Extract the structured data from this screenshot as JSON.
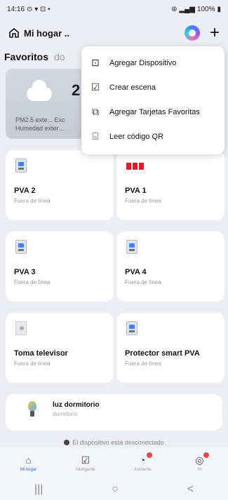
{
  "status_bar": {
    "time": "14:16",
    "left_icons": "⊙ ▾ ⊡ •",
    "right_text": "100%"
  },
  "header": {
    "home_title": "Mi hogar ..",
    "home_icon": "home-icon",
    "assistant_icon": "assistant-icon",
    "plus_icon": "plus-icon"
  },
  "tabs": {
    "active": "Favoritos",
    "inactive": "do"
  },
  "weather": {
    "temp": "2",
    "line1": "PM2.5 exte...  Exc",
    "line2": "Humedad exter..."
  },
  "devices": [
    {
      "name": "PVA 2",
      "status": "Fuera de línea"
    },
    {
      "name": "PVA 1",
      "status": "Fuera de línea"
    },
    {
      "name": "PVA 3",
      "status": "Fuera de línea"
    },
    {
      "name": "PVA 4",
      "status": "Fuera de línea"
    },
    {
      "name": "Toma televisor",
      "status": "Fuera de línea"
    },
    {
      "name": "Protector smart PVA",
      "status": "Fuera de línea"
    }
  ],
  "bulb": {
    "name": "luz dormitorio",
    "status": "dormitorio"
  },
  "notice": "El dispositivo está desconectado",
  "tabbar": [
    {
      "label": "Mi hogar",
      "icon": "home-icon",
      "active": true
    },
    {
      "label": "Inteligente",
      "icon": "check-icon",
      "active": false
    },
    {
      "label": "Asistente",
      "icon": "assistant-icon",
      "active": false
    },
    {
      "label": "Yo",
      "icon": "profile-icon",
      "active": false
    }
  ],
  "sysnav": {
    "recent": "|||",
    "home": "○",
    "back": "<"
  },
  "menu": [
    {
      "label": "Agregar Dispositivo",
      "icon": "add-device-icon"
    },
    {
      "label": "Crear escena",
      "icon": "create-scene-icon"
    },
    {
      "label": "Agregar Tarjetas Favoritas",
      "icon": "add-card-icon"
    },
    {
      "label": "Leer código QR",
      "icon": "qr-scan-icon"
    }
  ]
}
